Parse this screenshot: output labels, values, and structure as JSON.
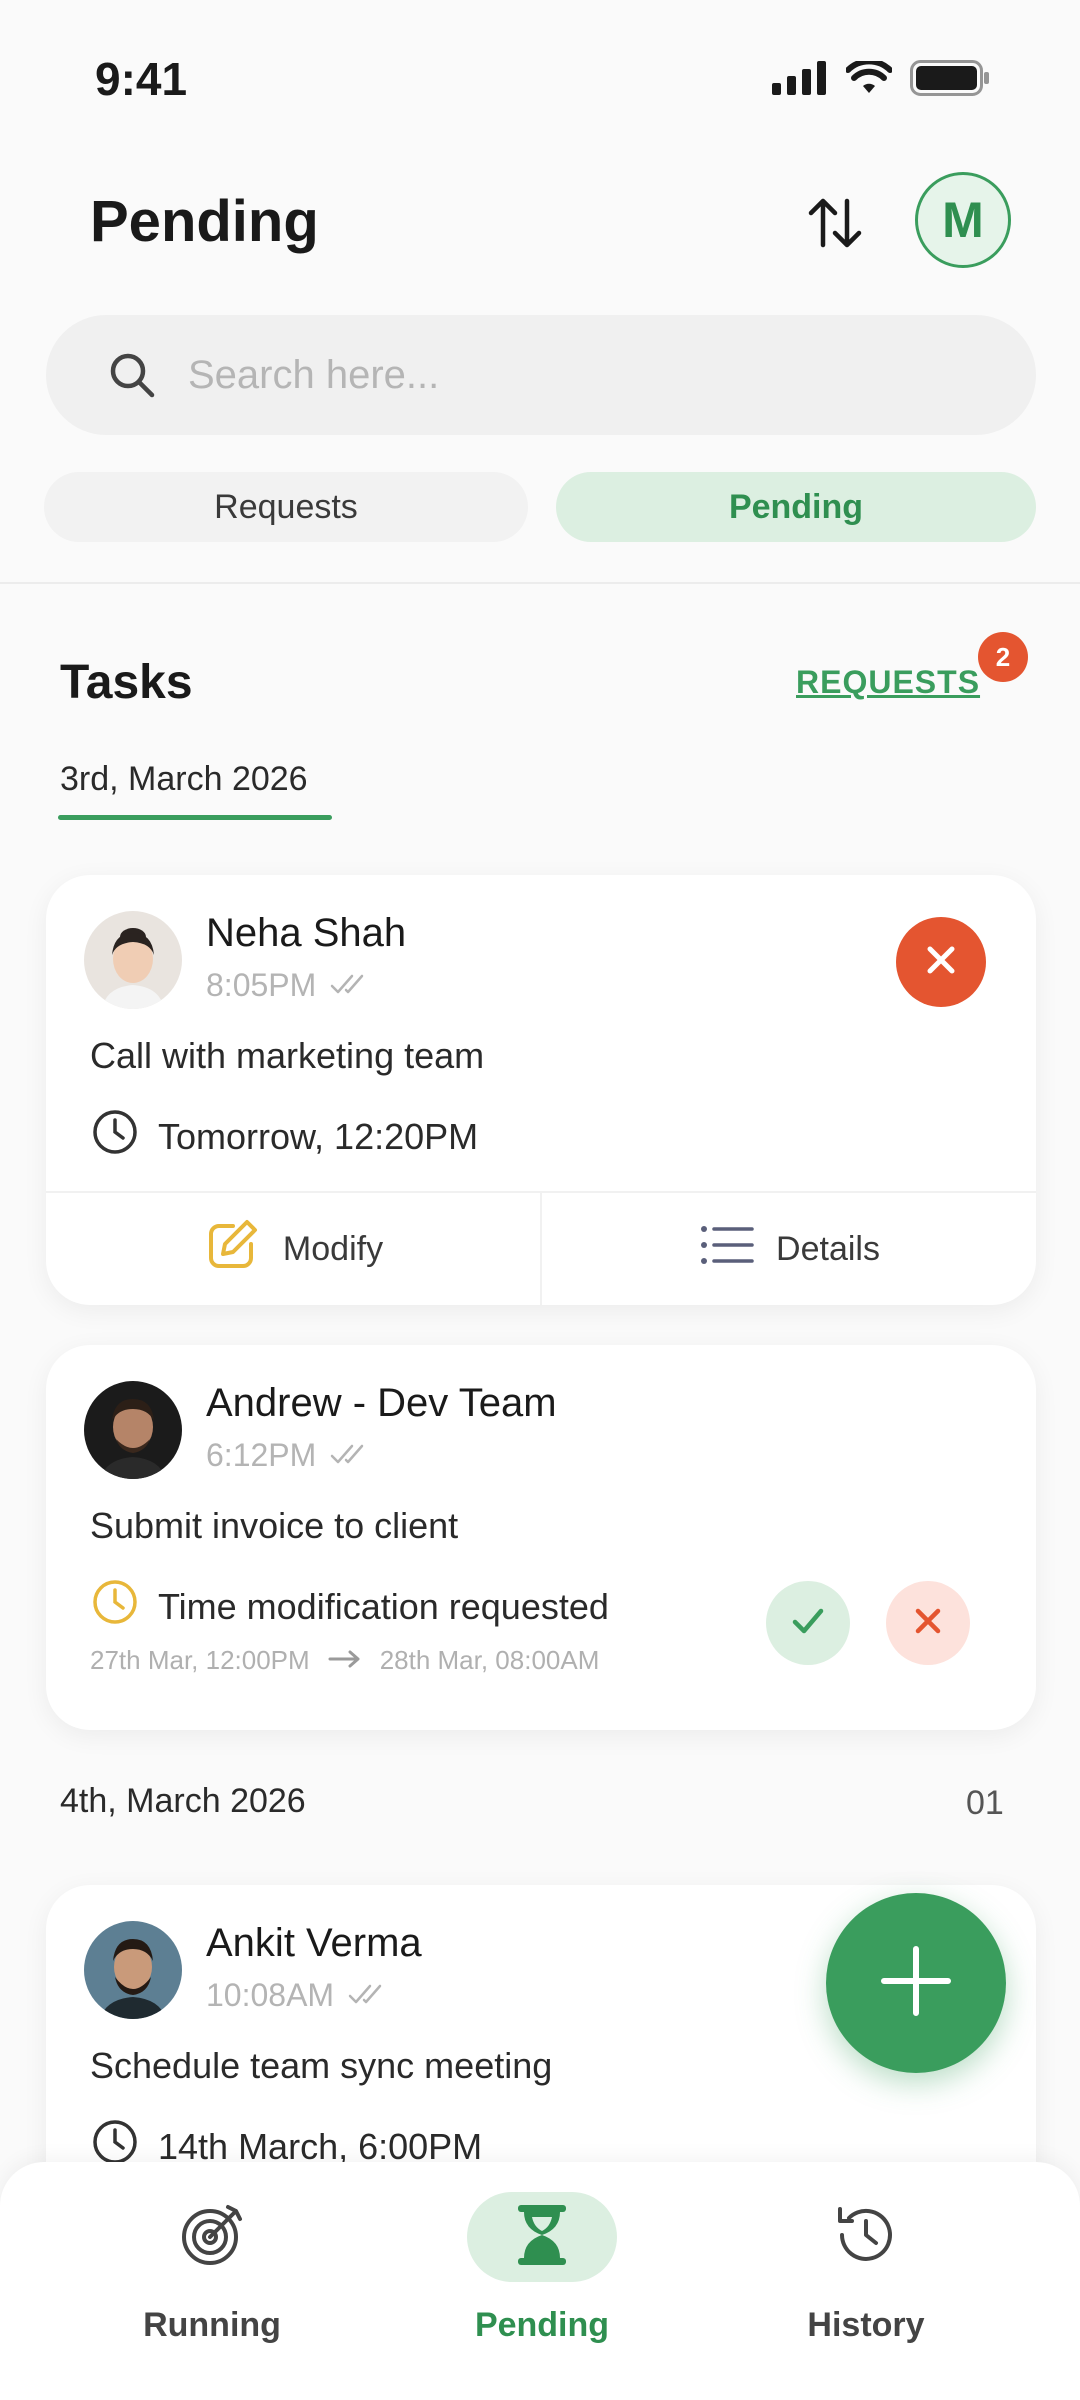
{
  "status_bar": {
    "time": "9:41"
  },
  "header": {
    "title": "Pending",
    "avatar_initial": "M"
  },
  "search": {
    "placeholder": "Search here..."
  },
  "segments": {
    "requests": "Requests",
    "pending": "Pending"
  },
  "tasks": {
    "title": "Tasks",
    "requests_link": "REQUESTS",
    "requests_badge": "2",
    "groups": [
      {
        "date": "3rd, March 2026",
        "cards": [
          {
            "name": "Neha Shah",
            "time": "8:05PM",
            "description": "Call with marketing team",
            "when": "Tomorrow, 12:20PM",
            "actions": {
              "modify": "Modify",
              "details": "Details"
            }
          },
          {
            "name": "Andrew - Dev Team",
            "time": "6:12PM",
            "description": "Submit invoice to client",
            "when": "Time modification requested",
            "route_from": "27th Mar, 12:00PM",
            "route_to": "28th Mar, 08:00AM"
          }
        ]
      },
      {
        "date": "4th, March 2026",
        "count": "01",
        "cards": [
          {
            "name": "Ankit Verma",
            "time": "10:08AM",
            "description": "Schedule team sync meeting",
            "when": "14th March, 6:00PM"
          }
        ]
      }
    ]
  },
  "bottom_nav": {
    "running": "Running",
    "pending": "Pending",
    "history": "History"
  },
  "colors": {
    "accent": "#3a9d5d",
    "danger": "#e45530",
    "accent_soft": "#dcefe1",
    "warning": "#e8b73a"
  }
}
